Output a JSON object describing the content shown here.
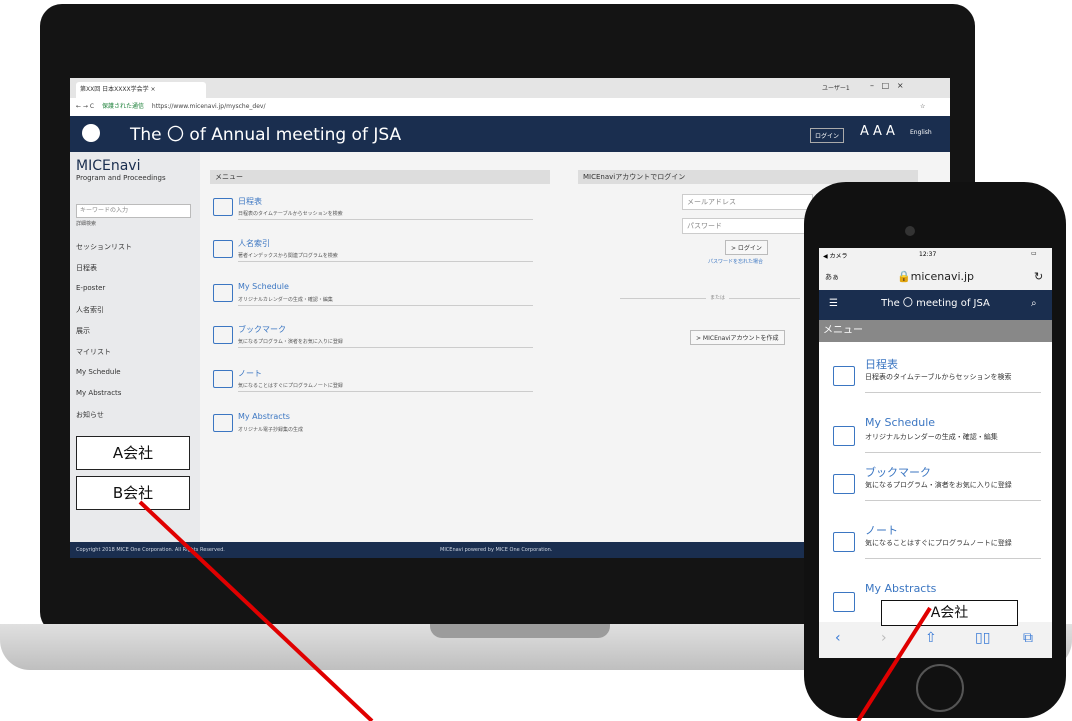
{
  "laptop": {
    "tab_title": "第XX回 日本XXXX学会学 ×",
    "url_secure": "保護された通信",
    "url": "https://www.micenavi.jp/mysche_dev/",
    "user_label": "ユーザー1",
    "site_title": "The 〇 of Annual meeting of JSA",
    "login_button": "ログイン",
    "font_size_label": "A A A",
    "english_link": "English",
    "brand": "MICEnavi",
    "brand_sub": "Program and Proceedings",
    "search_placeholder": "キーワードの入力",
    "search_detail": "詳細検索",
    "sidebar_items": [
      "セッションリスト",
      "日程表",
      "E-poster",
      "人名索引",
      "展示",
      "マイリスト",
      "My Schedule",
      "My Abstracts",
      "お知らせ"
    ],
    "company_a": "A会社",
    "company_b": "B会社",
    "menu_heading": "メニュー",
    "menu_items": [
      {
        "title": "日程表",
        "desc": "日程表のタイムテーブルからセッションを検索"
      },
      {
        "title": "人名索引",
        "desc": "著者インデックスから関連プログラムを検索"
      },
      {
        "title": "My Schedule",
        "desc": "オリジナルカレンダーの生成・確認・編集"
      },
      {
        "title": "ブックマーク",
        "desc": "気になるプログラム・演者をお気に入りに登録"
      },
      {
        "title": "ノート",
        "desc": "気になることはすぐにプログラムノートに登録"
      },
      {
        "title": "My Abstracts",
        "desc": "オリジナル電子抄録集の生成"
      }
    ],
    "login_heading": "MICEnaviアカウントでログイン",
    "email_placeholder": "メールアドレス",
    "password_placeholder": "パスワード",
    "login_submit": "> ログイン",
    "forgot_password": "パスワードを忘れた場合",
    "or_label": "または",
    "create_account": "> MICEnaviアカウントを作成",
    "footer_left": "Copyright 2018 MICE One Corporation. All Rights Reserved.",
    "footer_center": "MICEnavi powered by MICE One Corporation."
  },
  "phone": {
    "carrier": "◀ カメラ",
    "time": "12:37",
    "aa_label": "あぁ",
    "url": "micenavi.jp",
    "title": "The 〇 meeting of JSA",
    "menu_heading": "メニュー",
    "items": [
      {
        "title": "日程表",
        "desc": "日程表のタイムテーブルからセッションを検索"
      },
      {
        "title": "My Schedule",
        "desc": "オリジナルカレンダーの生成・確認・編集"
      },
      {
        "title": "ブックマーク",
        "desc": "気になるプログラム・演者をお気に入りに登録"
      },
      {
        "title": "ノート",
        "desc": "気になることはすぐにプログラムノートに登録"
      },
      {
        "title": "My Abstracts",
        "desc": ""
      }
    ],
    "company_a": "A会社"
  },
  "colors": {
    "header": "#1a2e4f",
    "link": "#3b76c2",
    "annotation": "#e00000"
  }
}
